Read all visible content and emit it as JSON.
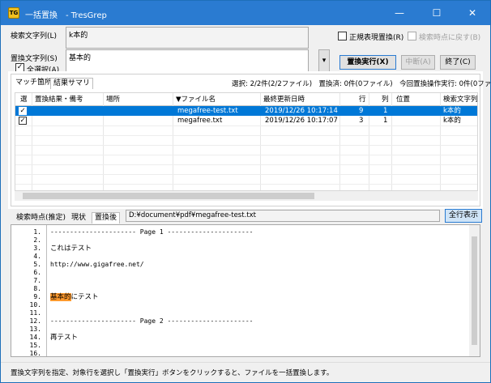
{
  "window": {
    "title": "一括置換　- TresGrep",
    "icon_text": "TG",
    "minimize": "—",
    "maximize": "☐",
    "close": "✕"
  },
  "search": {
    "label": "検索文字列(L)",
    "value": "k本的"
  },
  "replace": {
    "label": "置換文字列(S)",
    "value": "基本的",
    "dropdown": "▾",
    "select_all_label": "全選択(A)",
    "select_all_checked": "✓"
  },
  "options": {
    "regex_label": "正規表現置換(R)",
    "regex_checked": "",
    "revert_label": "検索時点に戻す(B)",
    "revert_checked": ""
  },
  "buttons": {
    "execute": "置換実行(X)",
    "abort": "中断(A)",
    "close": "終了(C)"
  },
  "result_tabs": {
    "matches": "マッチ箇所",
    "summary": "結果サマリ"
  },
  "status_line": "選択: 2/2件(2/2ファイル)　置換済: 0件(0ファイル)　今回置換操作実行: 0件(0ファイル)",
  "table": {
    "headers": [
      "選",
      "置換結果・備考",
      "場所",
      "▼ファイル名",
      "最終更新日時",
      "行",
      "列",
      "位置",
      "検索文字列"
    ],
    "rows": [
      {
        "check": "✓",
        "result": "",
        "place": "",
        "file": "megafree-test.txt",
        "date": "2019/12/26 10:17:14",
        "line": "9",
        "col": "1",
        "pos": "",
        "search": "k本的"
      },
      {
        "check": "✓",
        "result": "",
        "place": "",
        "file": "megafree.txt",
        "date": "2019/12/26 10:17:07",
        "line": "3",
        "col": "1",
        "pos": "",
        "search": "k本的"
      }
    ]
  },
  "preview_tabs": {
    "before": "検索時点(推定)",
    "current": "現状",
    "after": "置換後"
  },
  "file_path": "D:¥document¥pdf¥megafree-test.txt",
  "show_all": "全行表示",
  "editor": {
    "lines": [
      {
        "n": "1.",
        "t": "---------------------- Page 1 ----------------------"
      },
      {
        "n": "2.",
        "t": ""
      },
      {
        "n": "3.",
        "t": "これはテスト"
      },
      {
        "n": "4.",
        "t": ""
      },
      {
        "n": "5.",
        "t": "http://www.gigafree.net/"
      },
      {
        "n": "6.",
        "t": ""
      },
      {
        "n": "7.",
        "t": ""
      },
      {
        "n": "8.",
        "t": ""
      },
      {
        "n": "9.",
        "t": "にテスト"
      },
      {
        "n": "10.",
        "t": ""
      },
      {
        "n": "11.",
        "t": ""
      },
      {
        "n": "12.",
        "t": "---------------------- Page 2 ----------------------"
      },
      {
        "n": "13.",
        "t": ""
      },
      {
        "n": "14.",
        "t": "再テスト"
      },
      {
        "n": "15.",
        "t": ""
      },
      {
        "n": "16.",
        "t": ""
      }
    ],
    "match_text": "基本的"
  },
  "statusbar": "置換文字列を指定、対象行を選択し「置換実行」ボタンをクリックすると、ファイルを一括置換します。"
}
